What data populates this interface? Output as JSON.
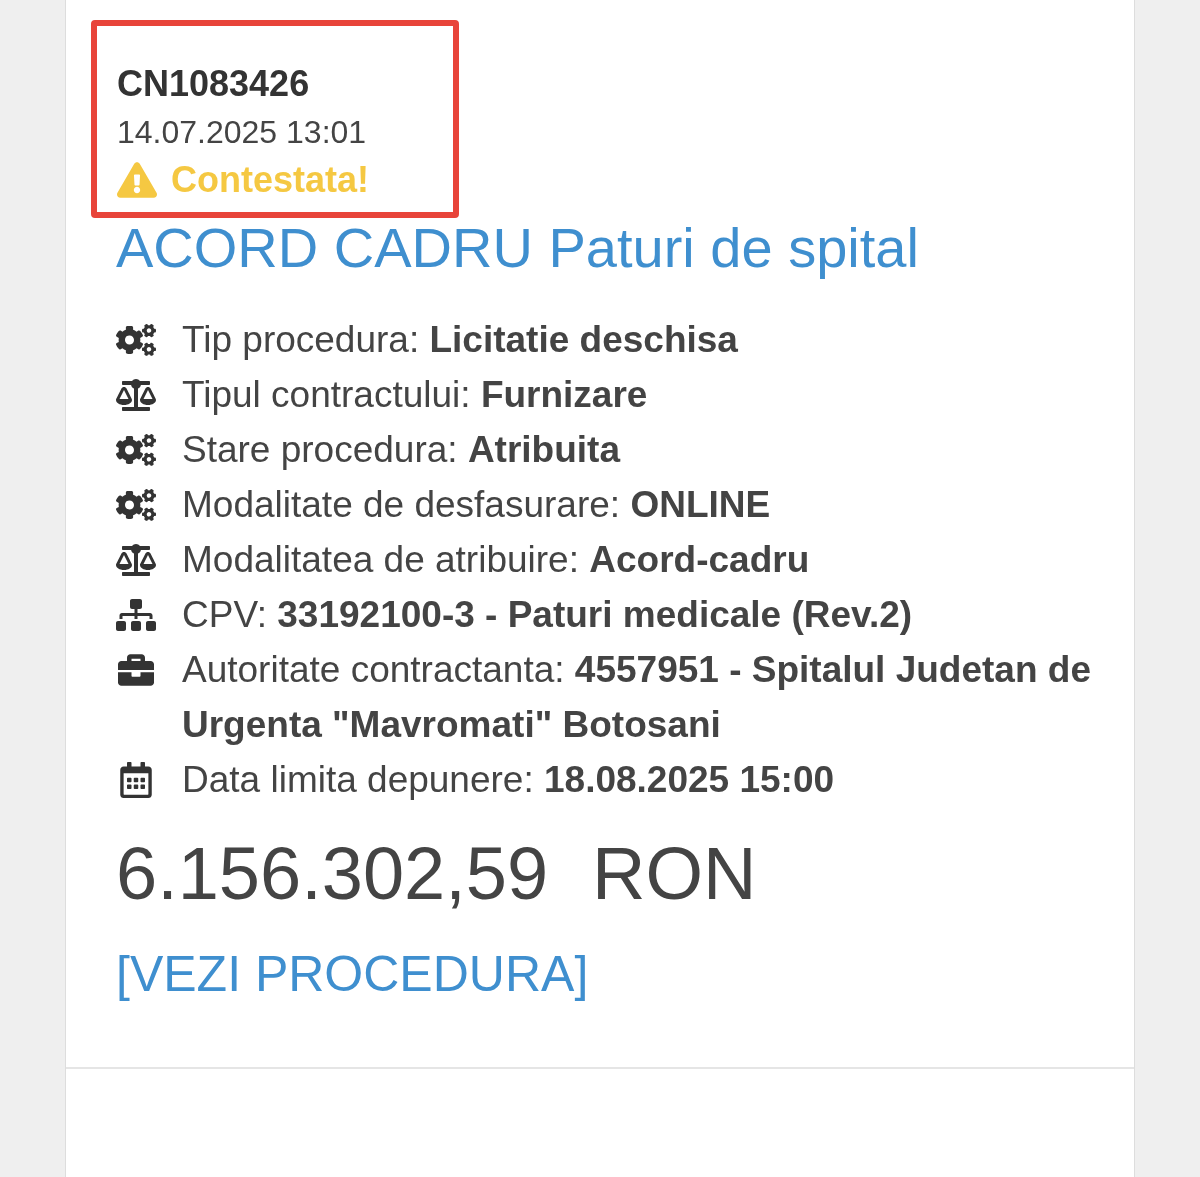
{
  "record": {
    "code": "CN1083426",
    "date": "14.07.2025 13:01",
    "status": {
      "kind": "warning",
      "label": "Contestata!"
    },
    "highlighted": true
  },
  "title": "ACORD CADRU Paturi de spital",
  "details": [
    {
      "kind": "gears",
      "text": "Tip procedura: **Licitatie deschisa**"
    },
    {
      "kind": "scale",
      "text": "Tipul contractului: **Furnizare**"
    },
    {
      "kind": "gears",
      "text": "Stare procedura: **Atribuita**"
    },
    {
      "kind": "gears",
      "text": "Modalitate de desfasurare: **ONLINE**"
    },
    {
      "kind": "scale",
      "text": "Modalitatea de atribuire: **Acord-cadru**"
    },
    {
      "kind": "sitemap",
      "text": "CPV: **33192100-3 - Paturi medicale (Rev.2)**"
    },
    {
      "kind": "briefcase",
      "text": "Autoritate contractanta: **4557951 - Spitalul Judetan de Urgenta \"Mavromati\" Botosani**"
    },
    {
      "kind": "calendar",
      "text": "Data limita depunere: **18.08.2025 15:00**"
    }
  ],
  "amount": {
    "value": "6.156.302,59",
    "currency": "RON"
  },
  "link": "[VEZI PROCEDURA]"
}
